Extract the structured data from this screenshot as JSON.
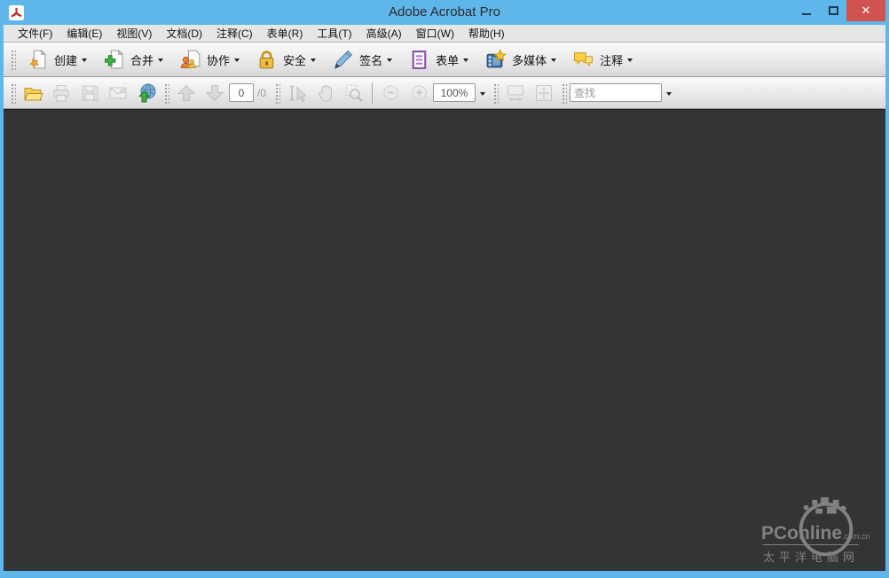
{
  "window": {
    "title": "Adobe Acrobat Pro"
  },
  "colors": {
    "titlebar_blue": "#5fb6ea",
    "close_button_red": "#d15350",
    "document_background": "#333436",
    "toolbar_gray": "#e9e9e9"
  },
  "icons": {
    "close_glyph": "✕"
  },
  "menu": {
    "items": [
      {
        "label": "文件(F)"
      },
      {
        "label": "编辑(E)"
      },
      {
        "label": "视图(V)"
      },
      {
        "label": "文档(D)"
      },
      {
        "label": "注释(C)"
      },
      {
        "label": "表单(R)"
      },
      {
        "label": "工具(T)"
      },
      {
        "label": "高级(A)"
      },
      {
        "label": "窗口(W)"
      },
      {
        "label": "帮助(H)"
      }
    ]
  },
  "toolbar_main": {
    "buttons": [
      {
        "label": "创建",
        "icon": "create-document-icon"
      },
      {
        "label": "合并",
        "icon": "combine-files-icon"
      },
      {
        "label": "协作",
        "icon": "collaborate-icon"
      },
      {
        "label": "安全",
        "icon": "security-lock-icon"
      },
      {
        "label": "签名",
        "icon": "sign-pen-icon"
      },
      {
        "label": "表单",
        "icon": "forms-icon"
      },
      {
        "label": "多媒体",
        "icon": "multimedia-film-icon"
      },
      {
        "label": "注释",
        "icon": "comment-bubble-icon"
      }
    ]
  },
  "toolbar_nav": {
    "page_current": "0",
    "page_total": "/0",
    "zoom_value": "100%",
    "find_placeholder": "查找"
  },
  "watermark": {
    "brand": "PConline",
    "suffix": ".com.cn",
    "subtitle": "太平洋电脑网"
  }
}
